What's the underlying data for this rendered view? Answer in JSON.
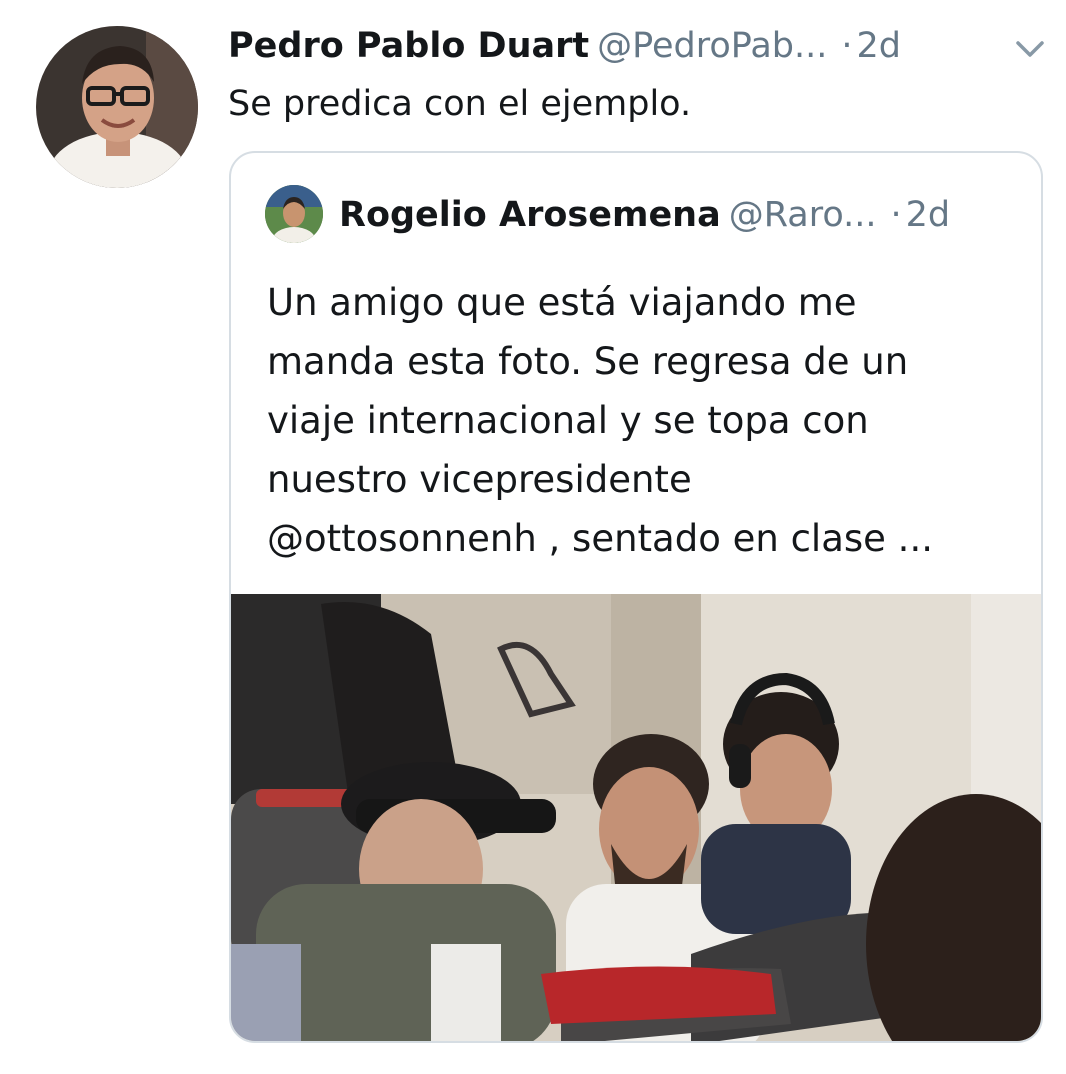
{
  "tweet": {
    "author_name": "Pedro Pablo Duart",
    "author_handle": "@PedroPab...",
    "separator": "·",
    "time": "2d",
    "text": "Se predica con el ejemplo.",
    "menu_icon": "chevron-down-icon"
  },
  "quoted_tweet": {
    "author_name": "Rogelio Arosemena",
    "author_handle": "@Raro...",
    "separator": "·",
    "time": "2d",
    "text_lines": [
      "Un amigo que está viajando me",
      "manda esta foto. Se regresa de un",
      "viaje internacional y se topa con",
      "nuestro vicepresidente",
      "@ottosonnenh , sentado en clase ..."
    ]
  },
  "colors": {
    "text_primary": "#14171a",
    "text_secondary": "#657786",
    "border": "#d6dde3"
  }
}
